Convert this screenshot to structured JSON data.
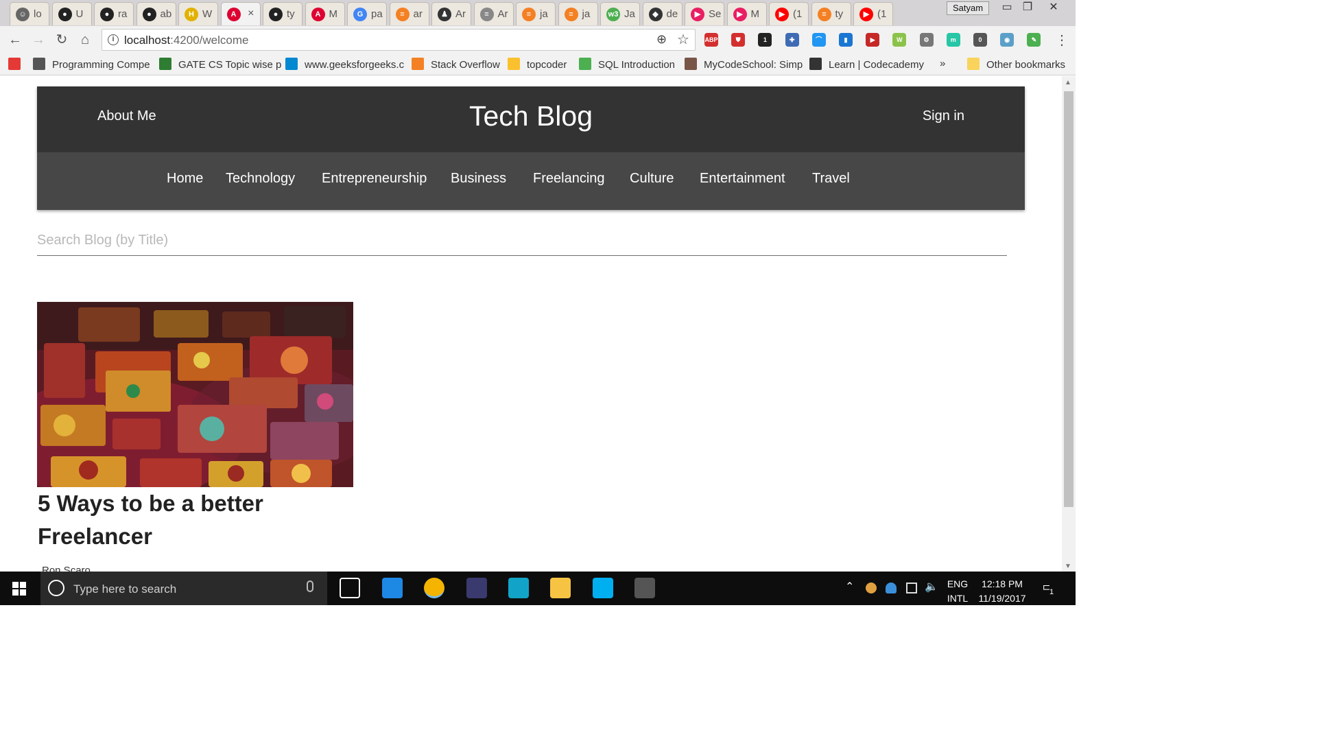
{
  "browser": {
    "profile": "Satyam",
    "url_host": "localhost",
    "url_rest": ":4200/welcome",
    "tabs": [
      {
        "label": "lo",
        "color": "#666666",
        "glyph": "☺"
      },
      {
        "label": "U",
        "color": "#222222",
        "glyph": "●"
      },
      {
        "label": "ra",
        "color": "#222222",
        "glyph": "●"
      },
      {
        "label": "ab",
        "color": "#222222",
        "glyph": "●"
      },
      {
        "label": "W",
        "color": "#e2b100",
        "glyph": "H"
      },
      {
        "label": "",
        "color": "#dd0031",
        "glyph": "A",
        "active": true
      },
      {
        "label": "ty",
        "color": "#222222",
        "glyph": "●"
      },
      {
        "label": "M",
        "color": "#dd0031",
        "glyph": "A"
      },
      {
        "label": "pa",
        "color": "#4285f4",
        "glyph": "G"
      },
      {
        "label": "ar",
        "color": "#f48024",
        "glyph": "≡"
      },
      {
        "label": "Ar",
        "color": "#333333",
        "glyph": "♟"
      },
      {
        "label": "Ar",
        "color": "#888888",
        "glyph": "≡"
      },
      {
        "label": "ja",
        "color": "#f48024",
        "glyph": "≡"
      },
      {
        "label": "ja",
        "color": "#f48024",
        "glyph": "≡"
      },
      {
        "label": "Ja",
        "color": "#4caf50",
        "glyph": "w3"
      },
      {
        "label": "de",
        "color": "#333333",
        "glyph": "◆"
      },
      {
        "label": "Se",
        "color": "#e91e63",
        "glyph": "▶"
      },
      {
        "label": "M",
        "color": "#e91e63",
        "glyph": "▶"
      },
      {
        "label": "(1",
        "color": "#ff0000",
        "glyph": "▶"
      },
      {
        "label": "ty",
        "color": "#f48024",
        "glyph": "≡"
      },
      {
        "label": "(1",
        "color": "#ff0000",
        "glyph": "▶"
      }
    ],
    "tab_close": "×",
    "bookmarks": [
      {
        "label": "",
        "color": "#e53935"
      },
      {
        "label": "Programming Compe",
        "color": "#555555"
      },
      {
        "label": "GATE CS Topic wise p",
        "color": "#2e7d32"
      },
      {
        "label": "www.geeksforgeeks.c",
        "color": "#0288d1"
      },
      {
        "label": "Stack Overflow",
        "color": "#f48024"
      },
      {
        "label": "topcoder",
        "color": "#fbc02d"
      },
      {
        "label": "SQL Introduction",
        "color": "#4caf50"
      },
      {
        "label": "MyCodeSchool: Simp",
        "color": "#795548"
      },
      {
        "label": "Learn | Codecademy",
        "color": "#333333"
      },
      {
        "label": "»",
        "color": ""
      },
      {
        "label": "Other bookmarks",
        "color": "#f9d35b"
      }
    ],
    "extensions": [
      {
        "glyph": "ABP",
        "color": "#d32f2f"
      },
      {
        "glyph": "⛊",
        "color": "#d32f2f"
      },
      {
        "glyph": "1",
        "color": "#222222"
      },
      {
        "glyph": "✚",
        "color": "#3f6bb5"
      },
      {
        "glyph": "⌒",
        "color": "#2196f3"
      },
      {
        "glyph": "▮",
        "color": "#1976d2"
      },
      {
        "glyph": "▶",
        "color": "#c62828"
      },
      {
        "glyph": "W",
        "color": "#8bc34a"
      },
      {
        "glyph": "⚙",
        "color": "#777777"
      },
      {
        "glyph": "m",
        "color": "#26c6a6"
      },
      {
        "glyph": "0",
        "color": "#555555"
      },
      {
        "glyph": "◉",
        "color": "#5aa0c8"
      },
      {
        "glyph": "✎",
        "color": "#4caf50"
      }
    ]
  },
  "site": {
    "about": "About Me",
    "brand": "Tech Blog",
    "signin": "Sign in",
    "categories": [
      "Home",
      "Technology",
      "Entrepreneurship",
      "Business",
      "Freelancing",
      "Culture",
      "Entertainment",
      "Travel"
    ],
    "search_placeholder": "Search Blog (by Title)",
    "posts": [
      {
        "title": "5 Ways to be a better Freelancer",
        "author": "Ron Scaro"
      }
    ]
  },
  "taskbar": {
    "search_placeholder": "Type here to search",
    "lang_top": "ENG",
    "lang_bottom": "INTL",
    "time": "12:18 PM",
    "date": "11/19/2017",
    "notification_count": "1",
    "apps": [
      {
        "name": "task-view",
        "color": "#ffffff"
      },
      {
        "name": "edge",
        "color": "#1e88e5"
      },
      {
        "name": "chrome",
        "color": "#f4b400"
      },
      {
        "name": "eclipse",
        "color": "#3b3a6e"
      },
      {
        "name": "webstorm",
        "color": "#12a4c8"
      },
      {
        "name": "file-explorer",
        "color": "#f6c343"
      },
      {
        "name": "skype",
        "color": "#00aff0"
      },
      {
        "name": "settings-app",
        "color": "#555555"
      }
    ]
  }
}
